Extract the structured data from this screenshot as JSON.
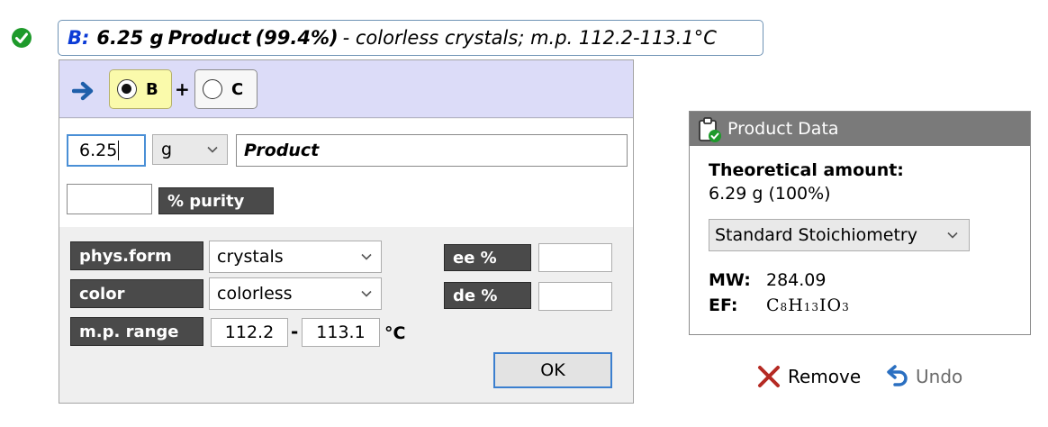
{
  "summary": {
    "reactant_label": "B:",
    "amount": "6.25 g",
    "product_name": "Product",
    "purity": "(99.4%)",
    "description": "- colorless crystals; m.p. 112.2-113.1°C"
  },
  "reactants": [
    {
      "label": "B",
      "selected": true
    },
    {
      "label": "C",
      "selected": false
    }
  ],
  "plus_sign": "+",
  "form": {
    "amount_value": "6.25",
    "unit_selected": "g",
    "product_name_value": "Product",
    "purity_value": "",
    "purity_label": "% purity",
    "phys_form_label": "phys.form",
    "phys_form_selected": "crystals",
    "color_label": "color",
    "color_selected": "colorless",
    "mp_label": "m.p. range",
    "mp_low": "112.2",
    "mp_dash": "-",
    "mp_high": "113.1",
    "mp_unit": "°C",
    "ee_label": "ee %",
    "ee_value": "",
    "de_label": "de %",
    "de_value": "",
    "ok_label": "OK"
  },
  "product_data": {
    "header": "Product Data",
    "theoretical_label": "Theoretical amount:",
    "theoretical_value": "6.29 g (100%)",
    "stoichiometry_selected": "Standard Stoichiometry",
    "mw_label": "MW:",
    "mw_value": "284.09",
    "ef_label": "EF:",
    "ef_formula": "C8H13IO3"
  },
  "actions": {
    "remove_label": "Remove",
    "undo_label": "Undo"
  },
  "colors": {
    "check": "#1e9a2b",
    "arrow": "#1f5faa",
    "remove_x": "#b52a23",
    "undo": "#2a6fc1",
    "reactant_bar": "#dcdcf8",
    "tag_bg": "#4a4a4a"
  },
  "icons": [
    "check-circle-icon",
    "arrow-right-icon",
    "clipboard-check-icon",
    "close-icon",
    "undo-icon",
    "chevron-down-icon"
  ]
}
